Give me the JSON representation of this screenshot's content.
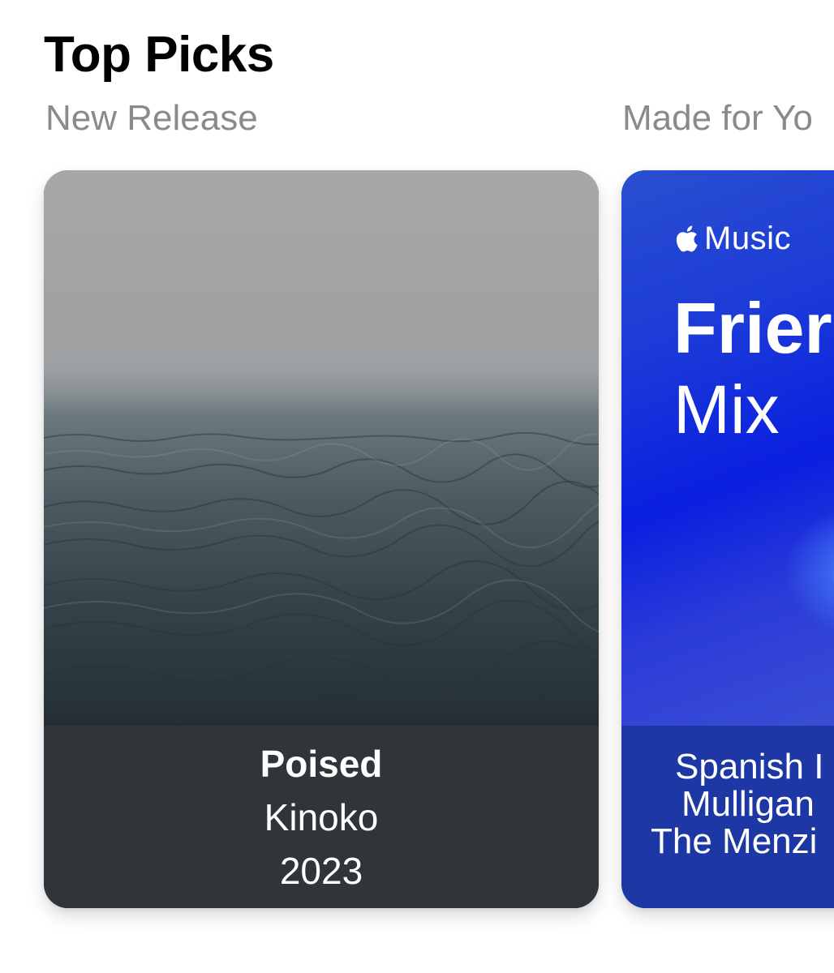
{
  "section": {
    "title": "Top Picks"
  },
  "cards": [
    {
      "kicker": "New Release",
      "artwork_icon": "fog-sea-artwork",
      "title": "Poised",
      "artist": "Kinoko",
      "year": "2023"
    },
    {
      "kicker": "Made for Yo",
      "artwork_icon": "friends-mix-artwork",
      "brand_icon": "apple-logo-icon",
      "brand_text": "Music",
      "mix_title": "Frier",
      "mix_subtitle": "Mix",
      "lines": [
        "Spanish I",
        "Mulligan",
        "The Menzi"
      ]
    }
  ],
  "colors": {
    "kicker_gray": "#8a8a8e",
    "card1_footer": "#2f3538",
    "card2_footer": "#1d38a4",
    "mix_blue": "#0a1fe0"
  }
}
